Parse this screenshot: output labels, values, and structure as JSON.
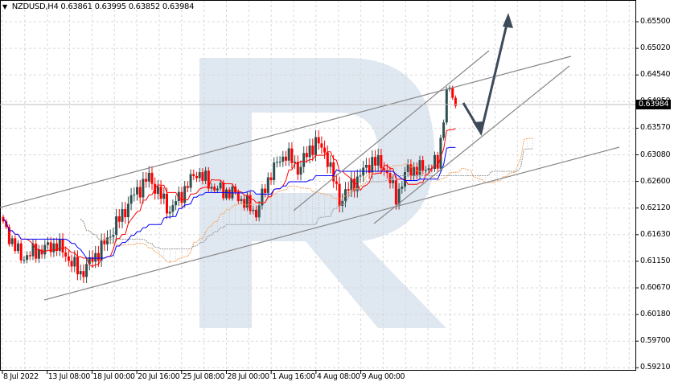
{
  "header": {
    "symbol": "NZDUSD,H4",
    "open": "0.63861",
    "high": "0.63995",
    "low": "0.63852",
    "close": "0.63984"
  },
  "price_axis": [
    "0.65500",
    "0.65020",
    "0.64540",
    "0.64050",
    "0.63570",
    "0.63080",
    "0.62600",
    "0.62120",
    "0.61630",
    "0.61150",
    "0.60670",
    "0.60180",
    "0.59700",
    "0.59210"
  ],
  "current_price": "0.63984",
  "time_axis": [
    "8 Jul 2022",
    "13 Jul 08:00",
    "18 Jul 00:00",
    "20 Jul 16:00",
    "25 Jul 08:00",
    "28 Jul 00:00",
    "1 Aug 16:00",
    "4 Aug 08:00",
    "9 Aug 00:00"
  ],
  "colors": {
    "bull": "#2f4f4f",
    "bear": "#ff0000",
    "tenkan": "#ff0000",
    "kijun": "#0000ff",
    "cloud_a": "#f4a460",
    "cloud_b": "#999999",
    "channel": "#888888",
    "arrow": "#3c4a5a",
    "watermark": "#dfe7f1"
  },
  "price_path": [
    [
      0,
      0.6184
    ],
    [
      6,
      0.6126
    ],
    [
      18,
      0.615
    ],
    [
      26,
      0.6097
    ],
    [
      34,
      0.615
    ],
    [
      44,
      0.624
    ],
    [
      49,
      0.627
    ],
    [
      56,
      0.621
    ],
    [
      65,
      0.628
    ],
    [
      71,
      0.625
    ],
    [
      78,
      0.624
    ],
    [
      85,
      0.6206
    ],
    [
      90,
      0.628
    ],
    [
      95,
      0.6314
    ],
    [
      99,
      0.6285
    ],
    [
      105,
      0.6336
    ],
    [
      109,
      0.6305
    ],
    [
      113,
      0.6228
    ],
    [
      118,
      0.6262
    ],
    [
      124,
      0.63
    ],
    [
      128,
      0.629
    ],
    [
      132,
      0.6235
    ],
    [
      136,
      0.6285
    ],
    [
      141,
      0.6285
    ],
    [
      146,
      0.6295
    ],
    [
      149,
      0.6423
    ],
    [
      151,
      0.642
    ],
    [
      152,
      0.6398
    ]
  ]
}
